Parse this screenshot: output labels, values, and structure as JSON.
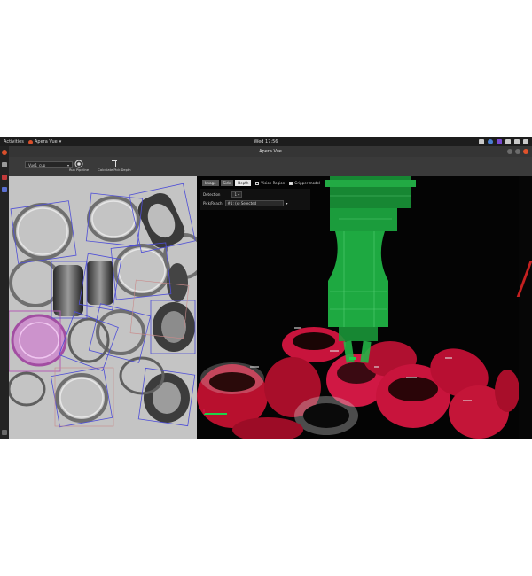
{
  "topbar": {
    "activities": "Activities",
    "app_menu": "Apera Vue",
    "clock": "Wed 17:56",
    "tray_icons": [
      "display-icon",
      "chat-icon",
      "settings-icon",
      "network-icon",
      "volume-icon",
      "power-icon"
    ]
  },
  "window": {
    "title": "Apera Vue"
  },
  "toolbar": {
    "project_select_value": "Vue1_cup",
    "run_pipeline_label": "Run Pipeline",
    "calculate_pick_label": "Calculate Pick Depth"
  },
  "view_tabs": [
    {
      "label": "Image",
      "active": false
    },
    {
      "label": "Side",
      "active": false
    },
    {
      "label": "Depth",
      "active": true
    }
  ],
  "view_options": [
    {
      "label": "Vision Region",
      "checked": false
    },
    {
      "label": "Gripper model",
      "checked": true
    }
  ],
  "detection_panel": {
    "detection_label": "Detection",
    "detection_value": "1",
    "pick_label": "Pick/Reach",
    "pick_value": "#1: (x) Selected"
  },
  "colors": {
    "accent_close": "#e0522b",
    "gripper_green": "#1fd14a",
    "ring_red": "#c8143c",
    "bbox_blue": "#4f4fd6",
    "selected_magenta": "#d36bd3"
  }
}
